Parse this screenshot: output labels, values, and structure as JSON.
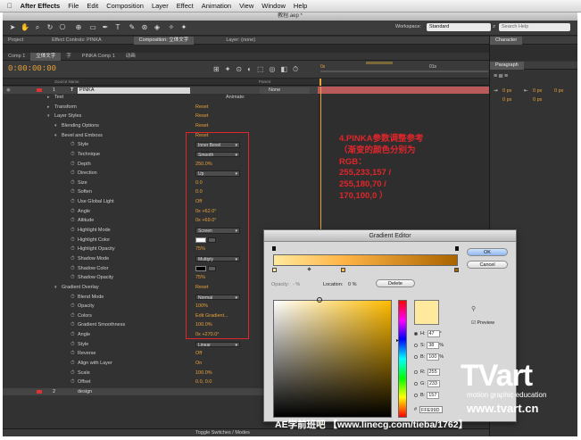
{
  "menubar": {
    "apple": "",
    "app": "After Effects",
    "items": [
      "File",
      "Edit",
      "Composition",
      "Layer",
      "Effect",
      "Animation",
      "View",
      "Window",
      "Help"
    ]
  },
  "window_title": "教程.aep *",
  "toolbar": {
    "workspace_label": "Workspace:",
    "workspace_value": "Standard",
    "search_placeholder": "Search Help"
  },
  "tabs": {
    "project": "Project",
    "effect_controls": "Effect Controls: PINKA",
    "composition": "Composition: 立体文字",
    "layer": "Layer: (none)",
    "character": "Character"
  },
  "timeline_tabs": [
    "Comp 1",
    "立体文字",
    "字",
    "PINKA Comp 1",
    "动画"
  ],
  "timecode": "0:00:00:00",
  "columns": {
    "source_name": "Source Name",
    "parent": "Parent"
  },
  "ruler": {
    "t0": "0s",
    "t1": "01s"
  },
  "layer1": {
    "num": "1",
    "name": "PINKA",
    "parent": "None"
  },
  "layer2": {
    "num": "2",
    "name": "design"
  },
  "rows": [
    {
      "indent": 1,
      "label": "Text",
      "extra": "Animate:"
    },
    {
      "indent": 1,
      "label": "Transform",
      "value": "Reset"
    },
    {
      "indent": 1,
      "label": "Layer Styles",
      "value": "Reset"
    },
    {
      "indent": 2,
      "label": "Blending Options",
      "value": "Reset"
    },
    {
      "indent": 2,
      "label": "Bevel and Emboss",
      "value": "Reset"
    },
    {
      "indent": 3,
      "label": "Style",
      "dropdown": "Inner Bevel"
    },
    {
      "indent": 3,
      "label": "Technique",
      "dropdown": "Smooth"
    },
    {
      "indent": 3,
      "label": "Depth",
      "value": "250.0%"
    },
    {
      "indent": 3,
      "label": "Direction",
      "dropdown": "Up"
    },
    {
      "indent": 3,
      "label": "Size",
      "value": "0.0"
    },
    {
      "indent": 3,
      "label": "Soften",
      "value": "0.0"
    },
    {
      "indent": 3,
      "label": "Use Global Light",
      "value": "Off"
    },
    {
      "indent": 3,
      "label": "Angle",
      "value": "0x +62.0°"
    },
    {
      "indent": 3,
      "label": "Altitude",
      "value": "0x +69.0°"
    },
    {
      "indent": 3,
      "label": "Highlight Mode",
      "dropdown": "Screen"
    },
    {
      "indent": 3,
      "label": "Highlight Color",
      "swatch": "#ffffff"
    },
    {
      "indent": 3,
      "label": "Highlight Opacity",
      "value": "75%"
    },
    {
      "indent": 3,
      "label": "Shadow Mode",
      "dropdown": "Multiply"
    },
    {
      "indent": 3,
      "label": "Shadow Color",
      "swatch": "#000000"
    },
    {
      "indent": 3,
      "label": "Shadow Opacity",
      "value": "75%"
    },
    {
      "indent": 2,
      "label": "Gradient Overlay",
      "value": "Reset"
    },
    {
      "indent": 3,
      "label": "Blend Mode",
      "dropdown": "Normal"
    },
    {
      "indent": 3,
      "label": "Opacity",
      "value": "100%"
    },
    {
      "indent": 3,
      "label": "Colors",
      "value": "Edit Gradient..."
    },
    {
      "indent": 3,
      "label": "Gradient Smoothness",
      "value": "100.0%"
    },
    {
      "indent": 3,
      "label": "Angle",
      "value": "0x +270.0°"
    },
    {
      "indent": 3,
      "label": "Style",
      "dropdown": "Linear"
    },
    {
      "indent": 3,
      "label": "Reverse",
      "value": "Off"
    },
    {
      "indent": 3,
      "label": "Align with Layer",
      "value": "On"
    },
    {
      "indent": 3,
      "label": "Scale",
      "value": "100.0%"
    },
    {
      "indent": 3,
      "label": "Offset",
      "value": "0.0, 0.0"
    }
  ],
  "footer": "Toggle Switches / Modes",
  "paragraph": {
    "title": "Paragraph",
    "fields": [
      "0 px",
      "0 px",
      "0 px",
      "0 px",
      "0 px"
    ]
  },
  "annotation": [
    "4.PINKA参数调整参考",
    "（渐变的颜色分别为",
    "RGB：",
    "255,233,157 /",
    "255,180,70 /",
    "170,100,0 ）"
  ],
  "gradient_editor": {
    "title": "Gradient Editor",
    "ok": "OK",
    "cancel": "Cancel",
    "opacity_label": "Opacity:",
    "opacity_value": "- %",
    "location_label": "Location:",
    "location_value": "0 %",
    "delete": "Delete",
    "colors": [
      "#ffe99d",
      "#ffb446",
      "#aa6400"
    ],
    "preview_label": "Preview",
    "hsb": [
      {
        "k": "H:",
        "v": "47",
        "u": "°"
      },
      {
        "k": "S:",
        "v": "38",
        "u": "%"
      },
      {
        "k": "B:",
        "v": "100",
        "u": "%"
      },
      {
        "k": "R:",
        "v": "255",
        "u": ""
      },
      {
        "k": "G:",
        "v": "233",
        "u": ""
      },
      {
        "k": "B:",
        "v": "157",
        "u": ""
      }
    ],
    "hex": "FFE99D"
  },
  "watermark": {
    "brand": "TVart",
    "tagline": "motion graphic education",
    "url": "www.tvart.cn",
    "tieba": "AE学前班吧 【www.linecg.com/tieba/1762】"
  }
}
